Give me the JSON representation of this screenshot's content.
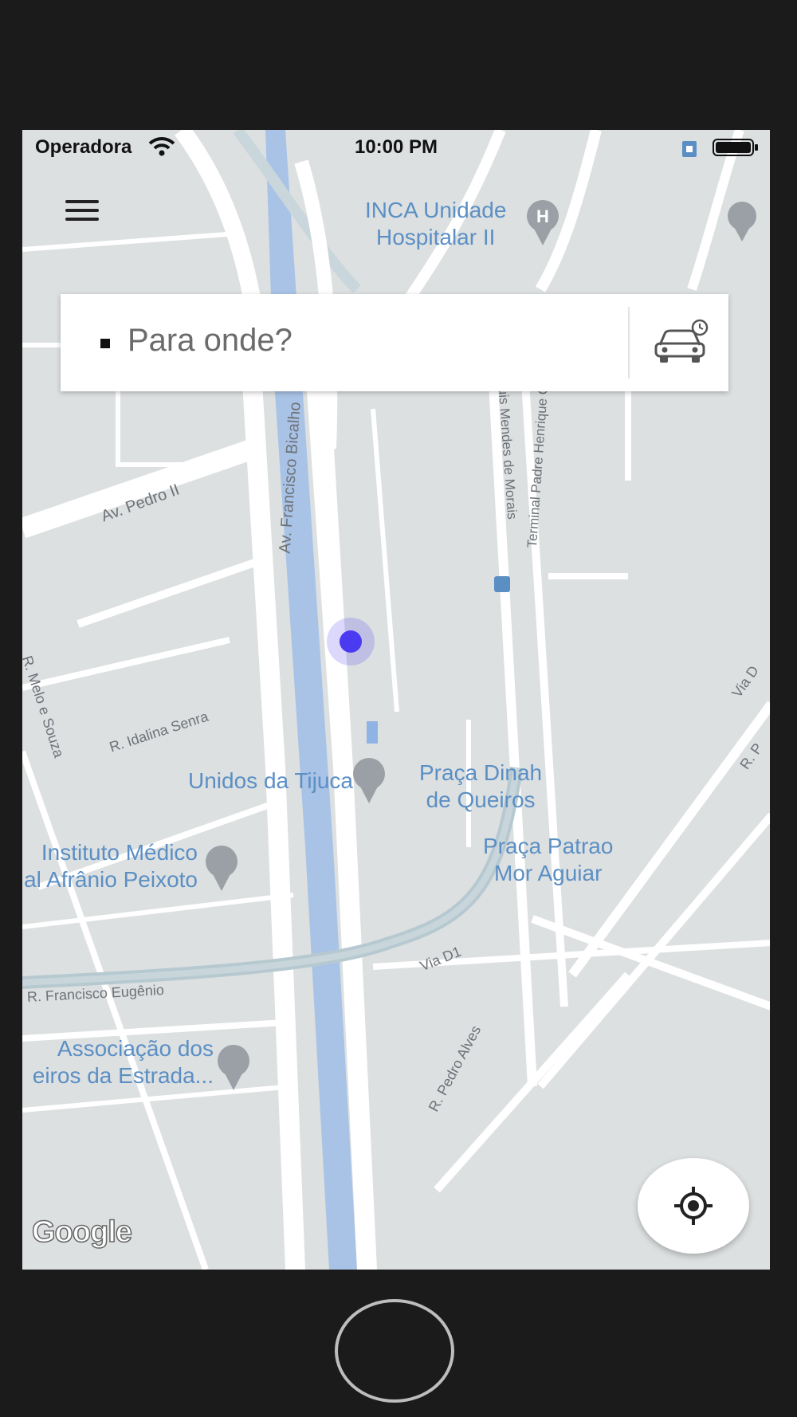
{
  "status_bar": {
    "carrier": "Operadora",
    "time": "10:00 PM"
  },
  "search": {
    "placeholder": "Para onde?"
  },
  "map": {
    "places": [
      {
        "line1": "INCA Unidade",
        "line2": "Hospitalar II"
      },
      {
        "line1": "Unidos da Tijuca"
      },
      {
        "line1": "Praça Dinah",
        "line2": "de Queiros"
      },
      {
        "line1": "Instituto Médico",
        "line2": "al Afrânio Peixoto"
      },
      {
        "line1": "Praça Patrao",
        "line2": "Mor Aguiar"
      },
      {
        "line1": "Associação dos",
        "line2": "eiros da Estrada..."
      }
    ],
    "streets": [
      "Av. Francisco Bicalho",
      "Av. Pedro II",
      "en. Luis Mendes de Morais",
      "Terminal Padre Henrique Otte",
      "R. Melo e Souza",
      "R. Idalina Senra",
      "Via D1",
      "R. Francisco Eugênio",
      "R. Pedro Alves",
      "Via D",
      "R. P"
    ],
    "attribution": "Google"
  },
  "colors": {
    "map_bg": "#dde0e1",
    "road": "#ffffff",
    "canal": "#a9c3e6",
    "label": "#5b8fc4",
    "user_dot": "#4a3af0"
  }
}
